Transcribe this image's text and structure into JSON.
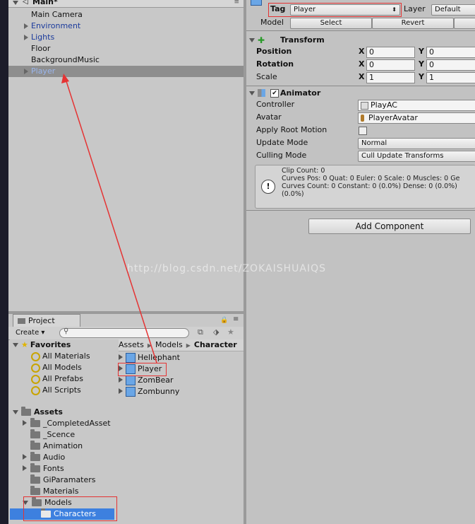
{
  "hierarchy": {
    "scene_title": "Main*",
    "items": [
      {
        "label": "Main Camera",
        "expandable": false,
        "color": "#111111"
      },
      {
        "label": "Environment",
        "expandable": true,
        "color": "#1a3a9c"
      },
      {
        "label": "Lights",
        "expandable": true,
        "color": "#1a3a9c"
      },
      {
        "label": "Floor",
        "expandable": false,
        "color": "#111111"
      },
      {
        "label": "BackgroundMusic",
        "expandable": false,
        "color": "#111111"
      },
      {
        "label": "Player",
        "expandable": true,
        "color": "#9ab6ee"
      }
    ]
  },
  "inspector": {
    "tag_label": "Tag",
    "tag_value": "Player",
    "layer_label": "Layer",
    "layer_value": "Default",
    "model_label": "Model",
    "select_button": "Select",
    "revert_button": "Revert",
    "transform": {
      "title": "Transform",
      "rows": [
        {
          "label": "Position",
          "bold": true,
          "x": "0",
          "y": "0"
        },
        {
          "label": "Rotation",
          "bold": true,
          "x": "0",
          "y": "0"
        },
        {
          "label": "Scale",
          "bold": false,
          "x": "1",
          "y": "1"
        }
      ],
      "x_axis": "X",
      "y_axis": "Y"
    },
    "animator": {
      "title": "Animator",
      "controller_label": "Controller",
      "controller_value": "PlayAC",
      "avatar_label": "Avatar",
      "avatar_value": "PlayerAvatar",
      "root_motion_label": "Apply Root Motion",
      "update_mode_label": "Update Mode",
      "update_mode_value": "Normal",
      "culling_mode_label": "Culling Mode",
      "culling_mode_value": "Cull Update Transforms",
      "info_lines": [
        "Clip Count: 0",
        "Curves Pos: 0 Quat: 0 Euler: 0 Scale: 0 Muscles: 0 Ge",
        "Curves Count: 0 Constant: 0 (0.0%) Dense: 0 (0.0%)",
        "(0.0%)"
      ]
    },
    "add_component": "Add Component"
  },
  "project": {
    "tab_label": "Project",
    "create_label": "Create",
    "favorites_title": "Favorites",
    "favorites": [
      "All Materials",
      "All Models",
      "All Prefabs",
      "All Scripts"
    ],
    "assets_title": "Assets",
    "assets": [
      {
        "label": "_CompletedAsset",
        "expandable": true
      },
      {
        "label": "_Scence",
        "expandable": false
      },
      {
        "label": "Animation",
        "expandable": false
      },
      {
        "label": "Audio",
        "expandable": true
      },
      {
        "label": "Fonts",
        "expandable": true
      },
      {
        "label": "GiParamaters",
        "expandable": false
      },
      {
        "label": "Materials",
        "expandable": false
      },
      {
        "label": "Models",
        "expandable": true
      }
    ],
    "selected_folder": "Characters",
    "breadcrumb": [
      "Assets",
      "Models",
      "Character"
    ],
    "files": [
      "Hellephant",
      "Player",
      "ZomBear",
      "Zombunny"
    ]
  },
  "watermark": "http://blog.csdn.net/ZOKAISHUAIQS",
  "colors": {
    "selection": "#3d80df",
    "highlight_box": "#e53333",
    "arrow": "#e53333"
  }
}
